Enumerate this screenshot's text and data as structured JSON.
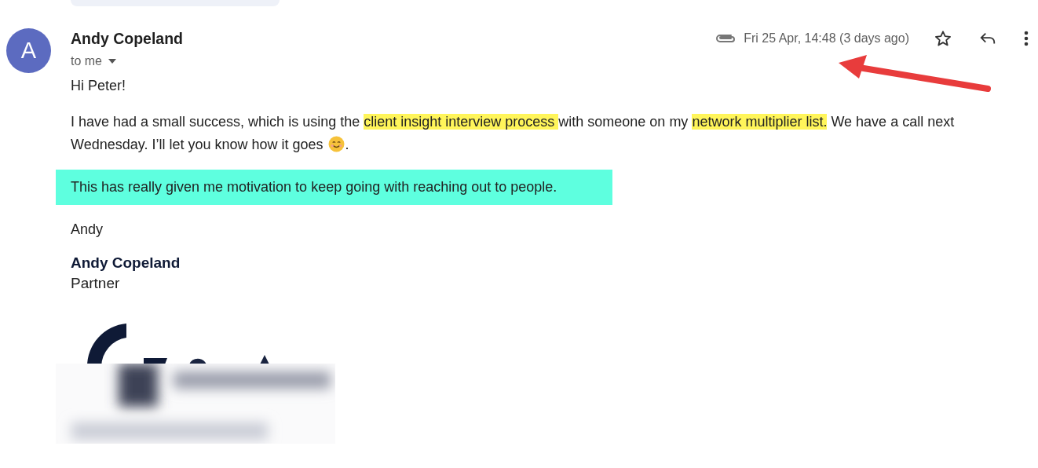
{
  "sender": {
    "initial": "A",
    "name": "Andy Copeland",
    "recipient": "to me"
  },
  "header": {
    "has_attachment": true,
    "date": "Fri 25 Apr, 14:48 (3 days ago)",
    "starred": false
  },
  "body": [
    {
      "kind": "text",
      "lines": [
        [
          {
            "text": "Hi Peter!",
            "highlight": false
          }
        ]
      ]
    },
    {
      "kind": "text",
      "lines": [
        [
          {
            "text": "I have had a small success, which is using the ",
            "highlight": false
          },
          {
            "text": "client insight interview process ",
            "highlight": true
          },
          {
            "text": "with someone on my ",
            "highlight": false
          },
          {
            "text": "network multiplier list.",
            "highlight": true
          },
          {
            "text": " We have a call next",
            "highlight": false
          }
        ],
        [
          {
            "text": "Wednesday. I’ll let you know how it goes ",
            "highlight": false
          },
          {
            "kind": "smiley"
          },
          {
            "text": ".",
            "highlight": false
          }
        ]
      ]
    },
    {
      "kind": "callout",
      "lines": [
        [
          {
            "text": "This has really given me motivation to keep going with reaching out to people.",
            "highlight": false
          }
        ]
      ]
    },
    {
      "kind": "text",
      "lines": [
        [
          {
            "text": "Andy",
            "highlight": false
          }
        ]
      ]
    }
  ],
  "signature": {
    "name": "Andy Copeland",
    "role": "Partner"
  }
}
